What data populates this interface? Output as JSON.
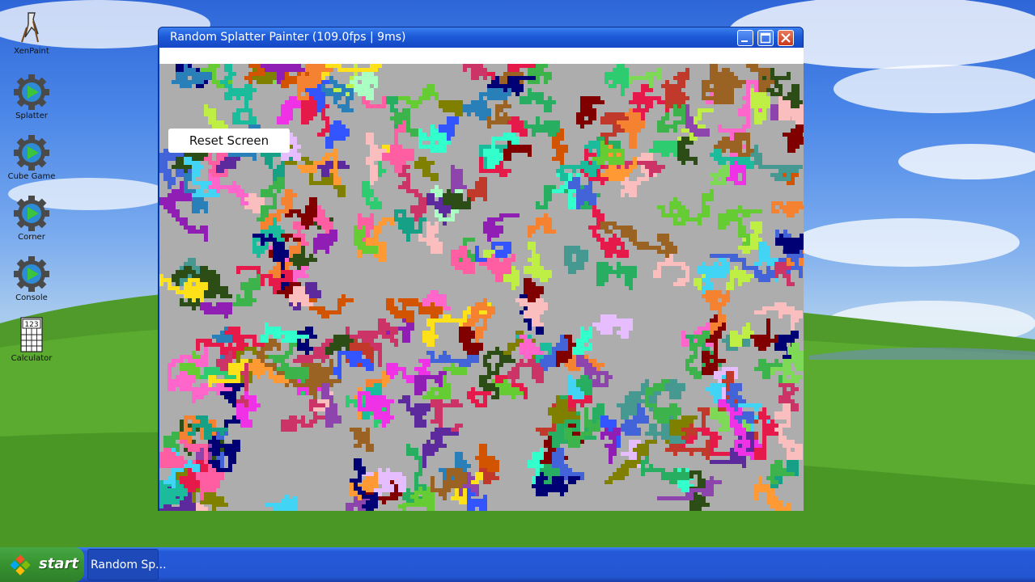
{
  "window": {
    "title": "Random Splatter Painter (109.0fps | 9ms)",
    "reset_label": "Reset Screen"
  },
  "desktop_icons": [
    {
      "label": "XenPaint",
      "icon": "xenpaint-icon"
    },
    {
      "label": "Splatter",
      "icon": "play-gear-icon"
    },
    {
      "label": "Cube Game",
      "icon": "play-gear-icon"
    },
    {
      "label": "Corner",
      "icon": "play-gear-icon"
    },
    {
      "label": "Console",
      "icon": "play-gear-icon"
    },
    {
      "label": "Calculator",
      "icon": "calculator-icon",
      "glyph_text": "123"
    }
  ],
  "taskbar": {
    "start_label": "start",
    "task_label": "Random Sp..."
  },
  "colors": {
    "canvas_bg": "#adadad",
    "title_bar": "#1d5ad8",
    "taskbar": "#2456d2",
    "start_green": "#36922f",
    "close_red": "#c9371b"
  }
}
